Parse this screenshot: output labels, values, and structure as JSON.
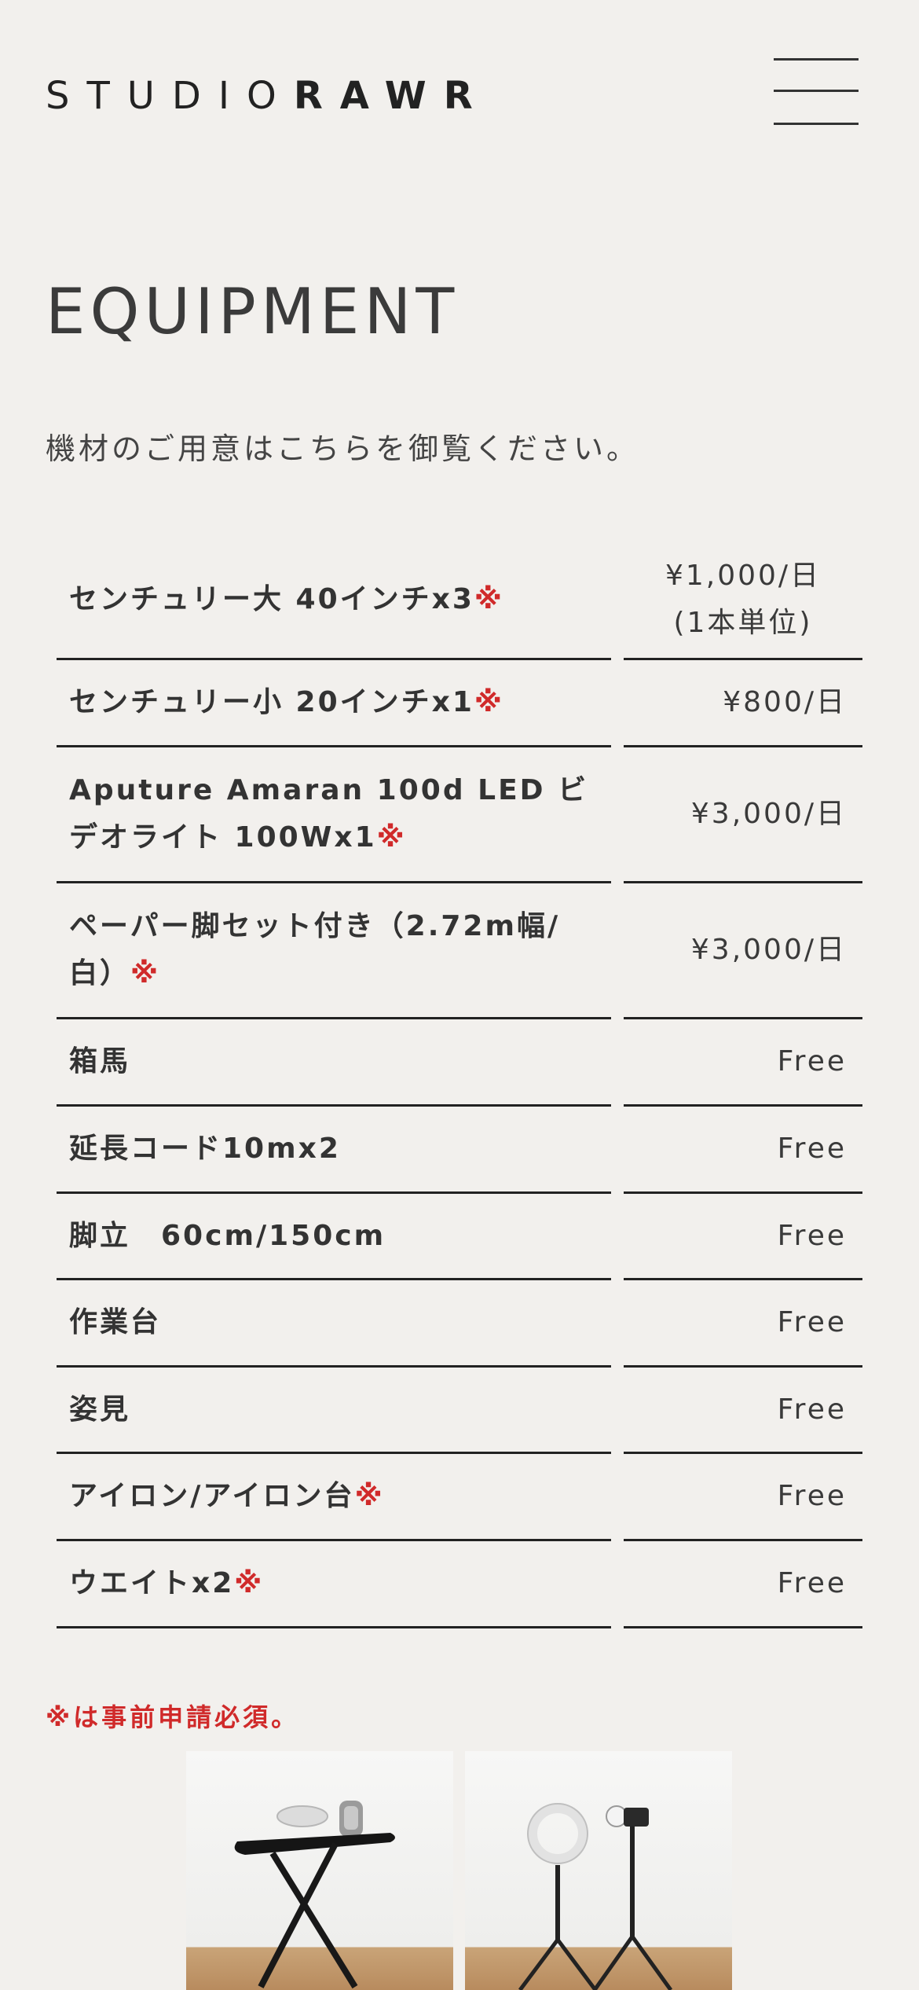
{
  "header": {
    "logo_light": "STUDIO",
    "logo_bold": "RAWR"
  },
  "page": {
    "title": "EQUIPMENT",
    "intro": "機材のご用意はこちらを御覧ください。",
    "note": "※は事前申請必須。"
  },
  "equipment": [
    {
      "name": "センチュリー大 40インチx3",
      "mark": "※",
      "price": "¥1,000/日\n(1本単位)"
    },
    {
      "name": "センチュリー小 20インチx1",
      "mark": "※",
      "price": "¥800/日"
    },
    {
      "name": "Aputure Amaran 100d LED ビデオライト 100Wx1",
      "mark": "※",
      "price": "¥3,000/日"
    },
    {
      "name": "ペーパー脚セット付き（2.72m幅/白）",
      "mark": "※",
      "price": "¥3,000/日"
    },
    {
      "name": "箱馬",
      "mark": "",
      "price": "Free"
    },
    {
      "name": "延長コード10mx2",
      "mark": "",
      "price": "Free"
    },
    {
      "name": "脚立　60cm/150cm",
      "mark": "",
      "price": "Free"
    },
    {
      "name": "作業台",
      "mark": "",
      "price": "Free"
    },
    {
      "name": "姿見",
      "mark": "",
      "price": "Free"
    },
    {
      "name": "アイロン/アイロン台",
      "mark": "※",
      "price": "Free"
    },
    {
      "name": "ウエイトx2",
      "mark": "※",
      "price": "Free"
    }
  ],
  "icons": {
    "menu": "hamburger-menu-icon"
  },
  "colors": {
    "background": "#f2f0ed",
    "text": "#3a3a3a",
    "accent_red": "#d02a2a"
  }
}
